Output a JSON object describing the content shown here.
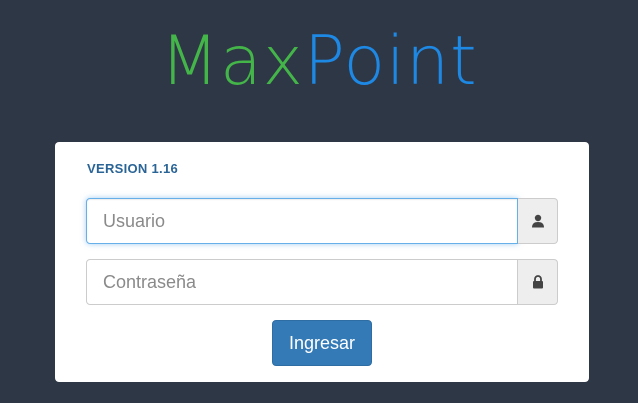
{
  "logo": {
    "part1": "Max",
    "part2": "Point",
    "color1": "#44b549",
    "color2": "#1e88e5"
  },
  "login": {
    "version": "VERSION 1.16",
    "username": {
      "placeholder": "Usuario",
      "value": "",
      "icon": "user-icon"
    },
    "password": {
      "placeholder": "Contraseña",
      "value": "",
      "icon": "lock-icon"
    },
    "submit_label": "Ingresar",
    "submit_color": "#337ab7"
  },
  "background_color": "#2e3745"
}
